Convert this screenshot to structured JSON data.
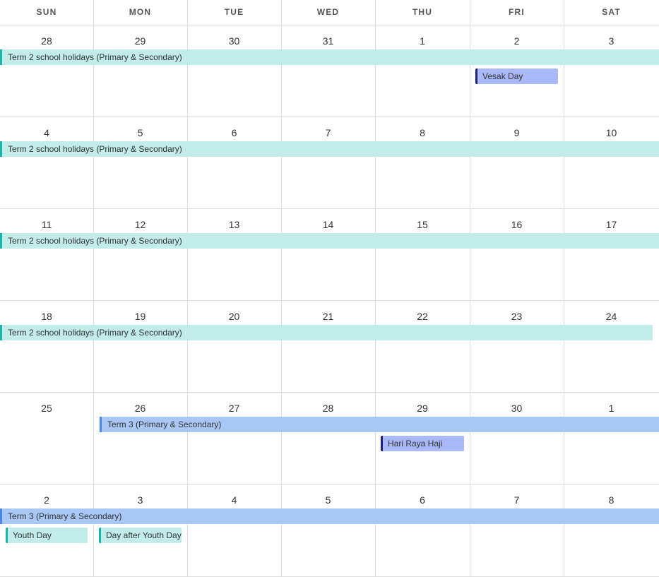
{
  "calendar": {
    "day_headers": [
      "SUN",
      "MON",
      "TUE",
      "WED",
      "THU",
      "FRI",
      "SAT"
    ],
    "weeks": [
      {
        "days": [
          "28",
          "29",
          "30",
          "31",
          "1",
          "2",
          "3"
        ],
        "events": [
          {
            "label": "Term 2 school holidays (Primary & Secondary)",
            "type": "holiday",
            "start": 0,
            "span": 7,
            "row": 0,
            "continues": true
          },
          {
            "label": "Vesak Day",
            "type": "public",
            "start": 5,
            "span": 1,
            "row": 1,
            "continues": false
          }
        ]
      },
      {
        "days": [
          "4",
          "5",
          "6",
          "7",
          "8",
          "9",
          "10"
        ],
        "events": [
          {
            "label": "Term 2 school holidays (Primary & Secondary)",
            "type": "holiday",
            "start": 0,
            "span": 7,
            "row": 0,
            "continues": true
          }
        ]
      },
      {
        "days": [
          "11",
          "12",
          "13",
          "14",
          "15",
          "16",
          "17"
        ],
        "events": [
          {
            "label": "Term 2 school holidays (Primary & Secondary)",
            "type": "holiday",
            "start": 0,
            "span": 7,
            "row": 0,
            "continues": true
          }
        ]
      },
      {
        "days": [
          "18",
          "19",
          "20",
          "21",
          "22",
          "23",
          "24"
        ],
        "events": [
          {
            "label": "Term 2 school holidays (Primary & Secondary)",
            "type": "holiday",
            "start": 0,
            "span": 7,
            "row": 0,
            "continues": false
          }
        ]
      },
      {
        "days": [
          "25",
          "26",
          "27",
          "28",
          "29",
          "30",
          "1"
        ],
        "events": [
          {
            "label": "Term 3 (Primary & Secondary)",
            "type": "term",
            "start": 1,
            "span": 6,
            "row": 0,
            "continues": true
          },
          {
            "label": "Hari Raya Haji",
            "type": "public",
            "start": 4,
            "span": 1,
            "row": 1,
            "continues": false
          }
        ]
      },
      {
        "days": [
          "2",
          "3",
          "4",
          "5",
          "6",
          "7",
          "8"
        ],
        "events": [
          {
            "label": "Term 3 (Primary & Secondary)",
            "type": "term",
            "start": 0,
            "span": 7,
            "row": 0,
            "continues": true
          },
          {
            "label": "Youth Day",
            "type": "school",
            "start": 0,
            "span": 1,
            "row": 1,
            "continues": false
          },
          {
            "label": "Day after Youth Day",
            "type": "school",
            "start": 1,
            "span": 1,
            "row": 1,
            "continues": false
          }
        ]
      }
    ]
  }
}
